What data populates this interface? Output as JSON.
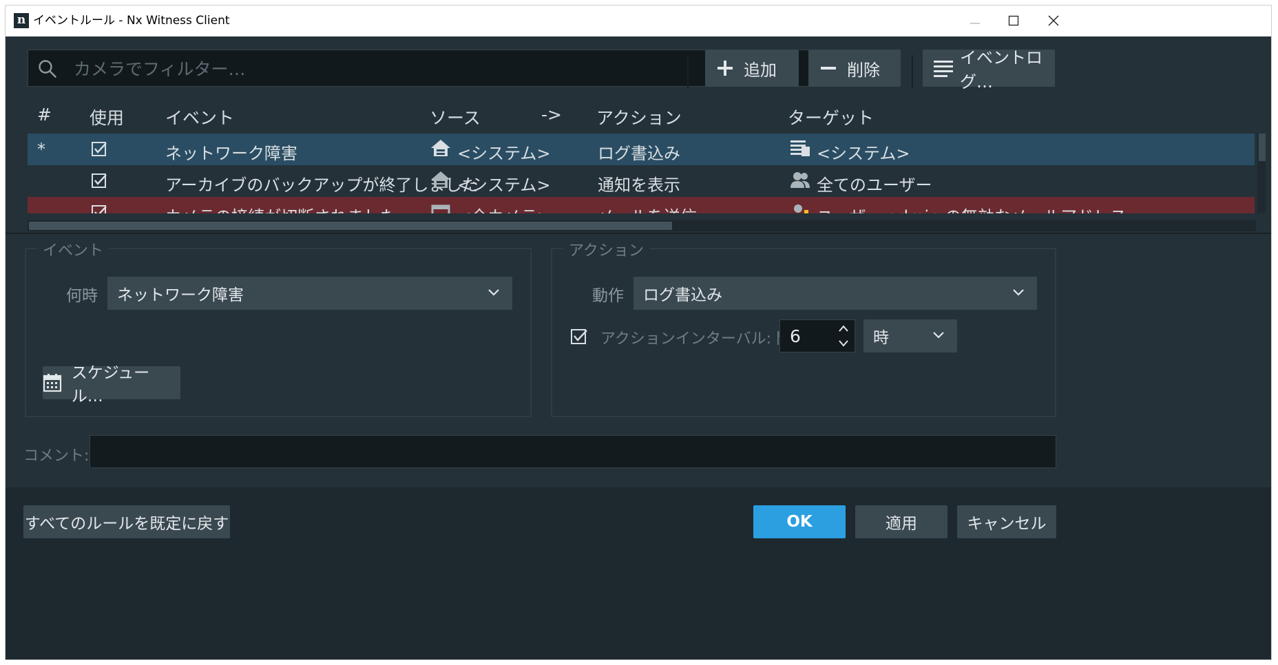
{
  "window": {
    "title": "イベントルール - Nx Witness Client",
    "logo_char": "n"
  },
  "toolbar": {
    "search_placeholder": "カメラでフィルター…",
    "add_label": "追加",
    "delete_label": "削除",
    "event_log_label": "イベントログ…"
  },
  "table": {
    "headers": {
      "number": "#",
      "enabled": "使用",
      "event": "イベント",
      "source": "ソース",
      "arrow": "->",
      "action": "アクション",
      "target": "ターゲット"
    },
    "rows": [
      {
        "number": "*",
        "enabled": true,
        "event": "ネットワーク障害",
        "source_icon": "server-icon",
        "source": "<システム>",
        "action": "ログ書込み",
        "target_icon": "event-log-icon",
        "target": "<システム>",
        "state": "selected"
      },
      {
        "number": "",
        "enabled": true,
        "event": "アーカイブのバックアップが終了しました",
        "source_icon": "server-icon",
        "source": "<システム>",
        "action": "通知を表示",
        "target_icon": "users-icon",
        "target": "全てのユーザー",
        "state": "normal"
      },
      {
        "number": "",
        "enabled": true,
        "event": "カメラの接続が切断されました",
        "source_icon": "camera-icon",
        "source": "<全カメラ>",
        "action": "メールを送信",
        "target_icon": "user-warning-icon",
        "target": "ユーザー admin の無効なメールアドレス",
        "state": "error"
      }
    ]
  },
  "event_group": {
    "title": "イベント",
    "when_label": "何時",
    "when_value": "ネットワーク障害",
    "schedule_label": "スケジュール…"
  },
  "action_group": {
    "title": "アクション",
    "do_label": "動作",
    "do_value": "ログ書込み",
    "interval_checked": true,
    "interval_label": "アクションインターバル: 間隔",
    "interval_value": "6",
    "interval_unit": "時"
  },
  "comment": {
    "label": "コメント:",
    "value": ""
  },
  "footer": {
    "reset_label": "すべてのルールを既定に戻す",
    "ok_label": "OK",
    "apply_label": "適用",
    "cancel_label": "キャンセル"
  },
  "colors": {
    "background": "#243139",
    "selected_row": "#2a4d63",
    "error_row": "#6a2a30",
    "primary": "#2b9fe0"
  }
}
